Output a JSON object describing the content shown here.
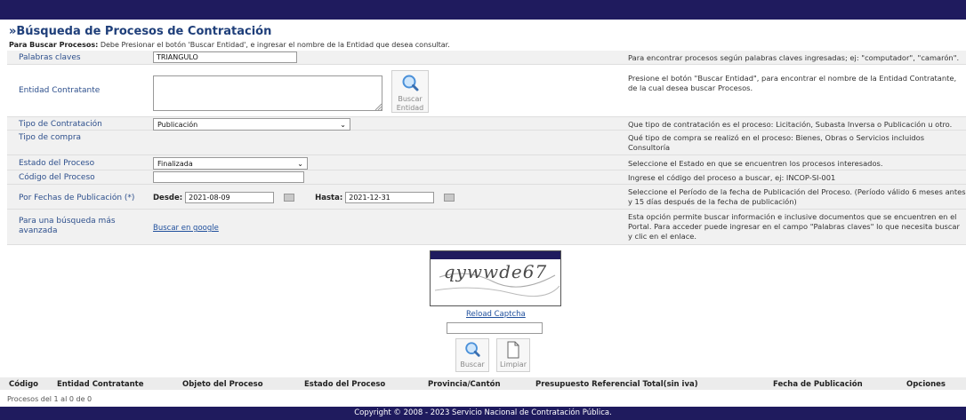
{
  "page": {
    "title": "»Búsqueda de Procesos de Contratación",
    "instr_bold": "Para Buscar Procesos:",
    "instr_text": " Debe Presionar el botón 'Buscar Entidad', e ingresar el nombre de la Entidad que desea consultar."
  },
  "form": {
    "keywords": {
      "label": "Palabras claves",
      "value": "TRIANGULO",
      "help": "Para encontrar procesos según palabras claves ingresadas; ej: \"computador\", \"camarón\"."
    },
    "entity": {
      "label": "Entidad Contratante",
      "button": "Buscar Entidad",
      "help": "Presione el botón \"Buscar Entidad\", para encontrar el nombre de la Entidad Contratante, de la cual desea buscar Procesos."
    },
    "contract_type": {
      "label": "Tipo de Contratación",
      "value": "Publicación",
      "help": "Que tipo de contratación es el proceso: Licitación, Subasta Inversa o Publicación u otro."
    },
    "purchase_type": {
      "label": "Tipo de compra",
      "help": "Qué tipo de compra se realizó en el proceso: Bienes, Obras o Servicios incluidos Consultoría"
    },
    "status": {
      "label": "Estado del Proceso",
      "value": "Finalizada",
      "help": "Seleccione el Estado en que se encuentren los procesos interesados."
    },
    "code": {
      "label": "Código del Proceso",
      "value": "",
      "help": "Ingrese el código del proceso a buscar, ej: INCOP-SI-001"
    },
    "dates": {
      "label": "Por Fechas de Publicación (*)",
      "from_label": "Desde:",
      "from_value": "2021-08-09",
      "to_label": "Hasta:",
      "to_value": "2021-12-31",
      "help": "Seleccione el Período de la fecha de Publicación del Proceso. (Período válido 6 meses antes y 15 días después de la fecha de publicación)"
    },
    "advanced": {
      "label": "Para una búsqueda más avanzada",
      "link": "Buscar en google",
      "help": "Esta opción permite buscar información e inclusive documentos que se encuentren en el Portal. Para acceder puede ingresar en el campo \"Palabras claves\" lo que necesita buscar y clic en el enlace."
    }
  },
  "captcha": {
    "text": "qywwde67",
    "reload": "Reload Captcha",
    "search_button": "Buscar",
    "clear_button": "Limpiar"
  },
  "results": {
    "columns": [
      "Código",
      "Entidad Contratante",
      "Objeto del Proceso",
      "Estado del Proceso",
      "Provincia/Cantón",
      "Presupuesto Referencial Total(sin iva)",
      "Fecha de Publicación",
      "Opciones"
    ],
    "summary": "Procesos del 1 al 0 de 0"
  },
  "footer": {
    "text": "Copyright © 2008 - 2023 Servicio Nacional de Contratación Pública."
  },
  "colors": {
    "navy": "#1f1b5e",
    "label_blue": "#2d4f8c"
  }
}
